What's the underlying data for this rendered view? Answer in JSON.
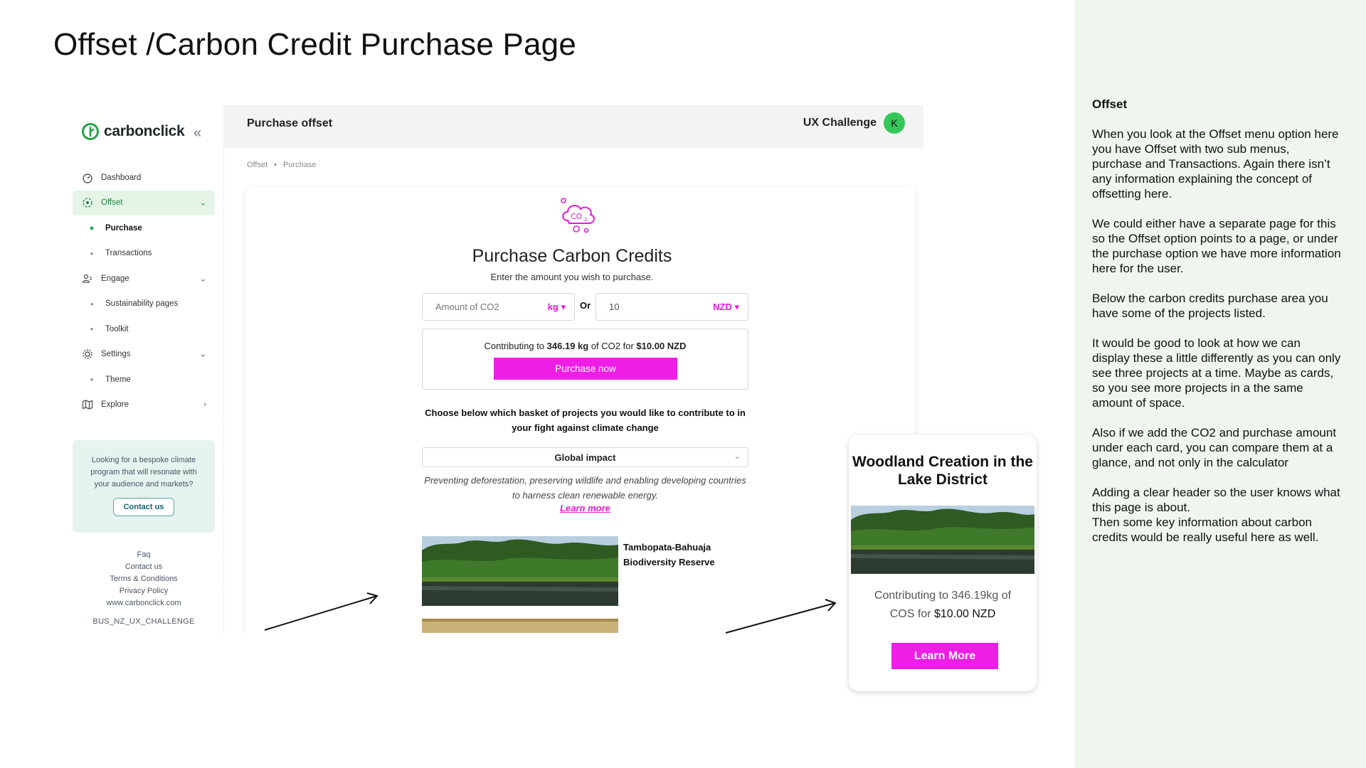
{
  "page": {
    "title": "Offset /Carbon Credit Purchase Page"
  },
  "sidebar": {
    "logo_text": "carbonclick",
    "items": [
      {
        "label": "Dashboard",
        "icon": "dashboard-icon"
      },
      {
        "label": "Offset",
        "icon": "offset-icon"
      },
      {
        "label": "Purchase"
      },
      {
        "label": "Transactions"
      },
      {
        "label": "Engage",
        "icon": "engage-icon"
      },
      {
        "label": "Sustainability pages"
      },
      {
        "label": "Toolkit"
      },
      {
        "label": "Settings",
        "icon": "gear-icon"
      },
      {
        "label": "Theme"
      },
      {
        "label": "Explore",
        "icon": "map-icon"
      }
    ],
    "promo": {
      "text": "Looking for a bespoke climate program that will resonate with your audience and markets?",
      "button": "Contact us"
    },
    "footer_links": [
      "Faq",
      "Contact us",
      "Terms & Conditions",
      "Privacy Policy",
      "www.carbonclick.com"
    ],
    "footer_code": "BUS_NZ_UX_CHALLENGE"
  },
  "topbar": {
    "title": "Purchase offset",
    "user": "UX Challenge",
    "avatar_initial": "K"
  },
  "breadcrumb": [
    "Offset",
    "Purchase"
  ],
  "purchase": {
    "title": "Purchase Carbon Credits",
    "subtitle": "Enter the amount you wish to purchase.",
    "co2_placeholder": "Amount of CO2",
    "co2_unit": "kg",
    "or_label": "Or",
    "amount_value": "10",
    "currency": "NZD",
    "contrib_prefix": "Contributing to ",
    "contrib_kg": "346.19 kg",
    "contrib_mid": " of CO2 for ",
    "contrib_price": "$10.00 NZD",
    "button": "Purchase now",
    "choose_text": "Choose below which basket of projects you would like to contribute to in your fight against climate change",
    "basket": "Global impact",
    "basket_desc": "Preventing deforestation, preserving wildlife and enabling developing countries to harness clean renewable energy.",
    "learn_more": "Learn more",
    "project_name": "Tambopata-Bahuaja Biodiversity Reserve"
  },
  "suggestion_card": {
    "title": "Woodland Creation in the Lake District",
    "text_prefix": "Contributing to 346.19kg of COS for ",
    "price": "$10.00 NZD",
    "button": "Learn More"
  },
  "notes": {
    "heading": "Offset",
    "paragraphs": [
      "When you look at the Offset menu option here you have Offset with two sub menus, purchase and Transactions. Again there isn’t any information explaining the concept of offsetting here.",
      "We could either have a separate page for this so the Offset option points to a page, or under the purchase option we have more information here for the user.",
      "Below the carbon credits purchase area you have some of the projects listed.",
      "It would be good to look at how we can display these a little differently as you can only see three projects at a time. Maybe as cards, so you see more projects in a the same amount of space.",
      "Also if we add the CO2 and purchase amount under each card,  you can compare them at a glance, and not only in the calculator",
      "Adding a clear header so the user knows what this page is about.\nThen some key information about carbon credits would be really useful here as well."
    ]
  },
  "colors": {
    "accent": "#ee1ee6",
    "brand_green": "#22a34a",
    "notes_bg": "#eef6ee"
  }
}
